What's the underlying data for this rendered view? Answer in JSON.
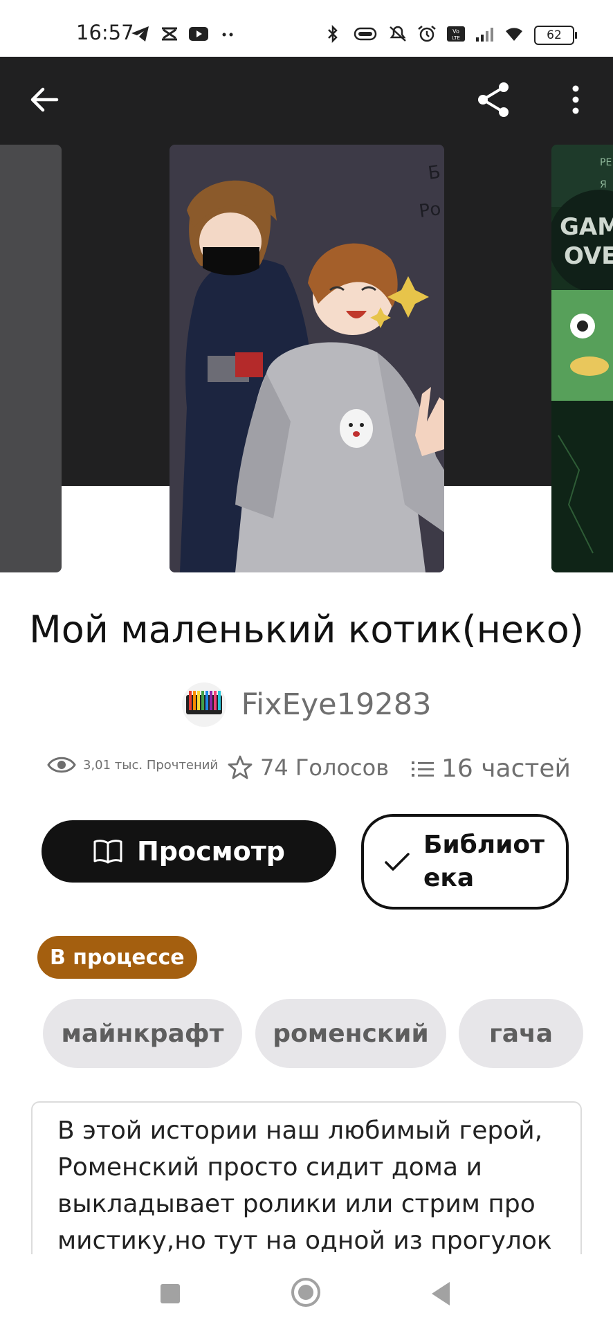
{
  "status_bar": {
    "time": "16:57",
    "battery": "62",
    "left_icons": [
      "telegram-icon",
      "capcut-icon",
      "youtube-icon",
      "more-dots-icon"
    ],
    "right_icons": [
      "bluetooth-icon",
      "vibrate-icon",
      "mute-icon",
      "alarm-icon",
      "volte-icon",
      "signal-icon",
      "wifi-icon"
    ]
  },
  "header": {
    "back_icon": "arrow-left-icon",
    "share_icon": "share-icon",
    "more_icon": "more-vertical-icon",
    "cover_fragments": [
      "Б",
      "Ро"
    ],
    "side_cover_fragments": [
      "GAM",
      "OVE",
      "РЕ",
      "Я"
    ]
  },
  "story": {
    "title": "Мой маленький котик(неко)",
    "author": "FixEye19283"
  },
  "stats": {
    "reads": "3,01 тыс. Прочтений",
    "votes": "74 Голосов",
    "parts": "16 частей"
  },
  "actions": {
    "read_label": "Просмотр",
    "library_label": "Библиотека"
  },
  "status_badge": "В процессе",
  "tags": [
    "майнкрафт",
    "роменский",
    "гача"
  ],
  "description": "В этой истории наш любимый герой, Роменский просто сидит дома и выкладывает ролики или стрим про мистику,но тут на одной из прогулок",
  "colors": {
    "header_bg": "#202021",
    "badge_bg": "#a45f0f",
    "tag_bg": "#e7e6e9",
    "primary_button": "#121212"
  }
}
